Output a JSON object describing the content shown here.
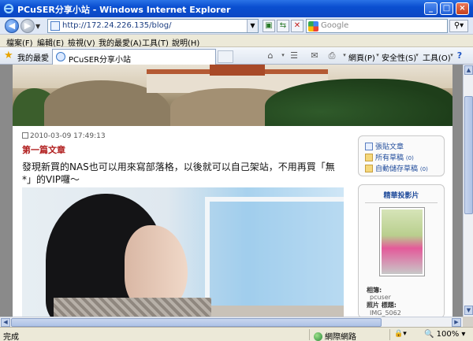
{
  "window": {
    "title": "PCuSER分享小站 - Windows Internet Explorer"
  },
  "address": {
    "url": "http://172.24.226.135/blog/"
  },
  "search": {
    "placeholder": "Google"
  },
  "menu": [
    "檔案(F)",
    "編輯(E)",
    "檢視(V)",
    "我的最愛(A)",
    "工具(T)",
    "說明(H)"
  ],
  "favorites": {
    "label": "我的最愛"
  },
  "tab": {
    "title": "PCuSER分享小站"
  },
  "commands": {
    "page": "網頁(P)",
    "safety": "安全性(S)",
    "tools": "工具(O)"
  },
  "post": {
    "date": "2010-03-09 17:49:13",
    "title": "第一篇文章",
    "body": "發現新買的NAS也可以用來寫部落格，以後就可以自己架站，不用再買「無*」的VIP囉～"
  },
  "sidebar": {
    "links": [
      {
        "label": "張貼文章",
        "count": ""
      },
      {
        "label": "所有草稿",
        "count": "(0)"
      },
      {
        "label": "自動儲存草稿",
        "count": "(0)"
      }
    ],
    "album": {
      "title": "精華投影片",
      "album_label": "相簿:",
      "album_value": "pcuser",
      "photo_label": "照片 標題:",
      "photo_value": "IMG_5062"
    }
  },
  "status": {
    "text": "完成",
    "zone": "網際網路",
    "zoom": "100%"
  }
}
